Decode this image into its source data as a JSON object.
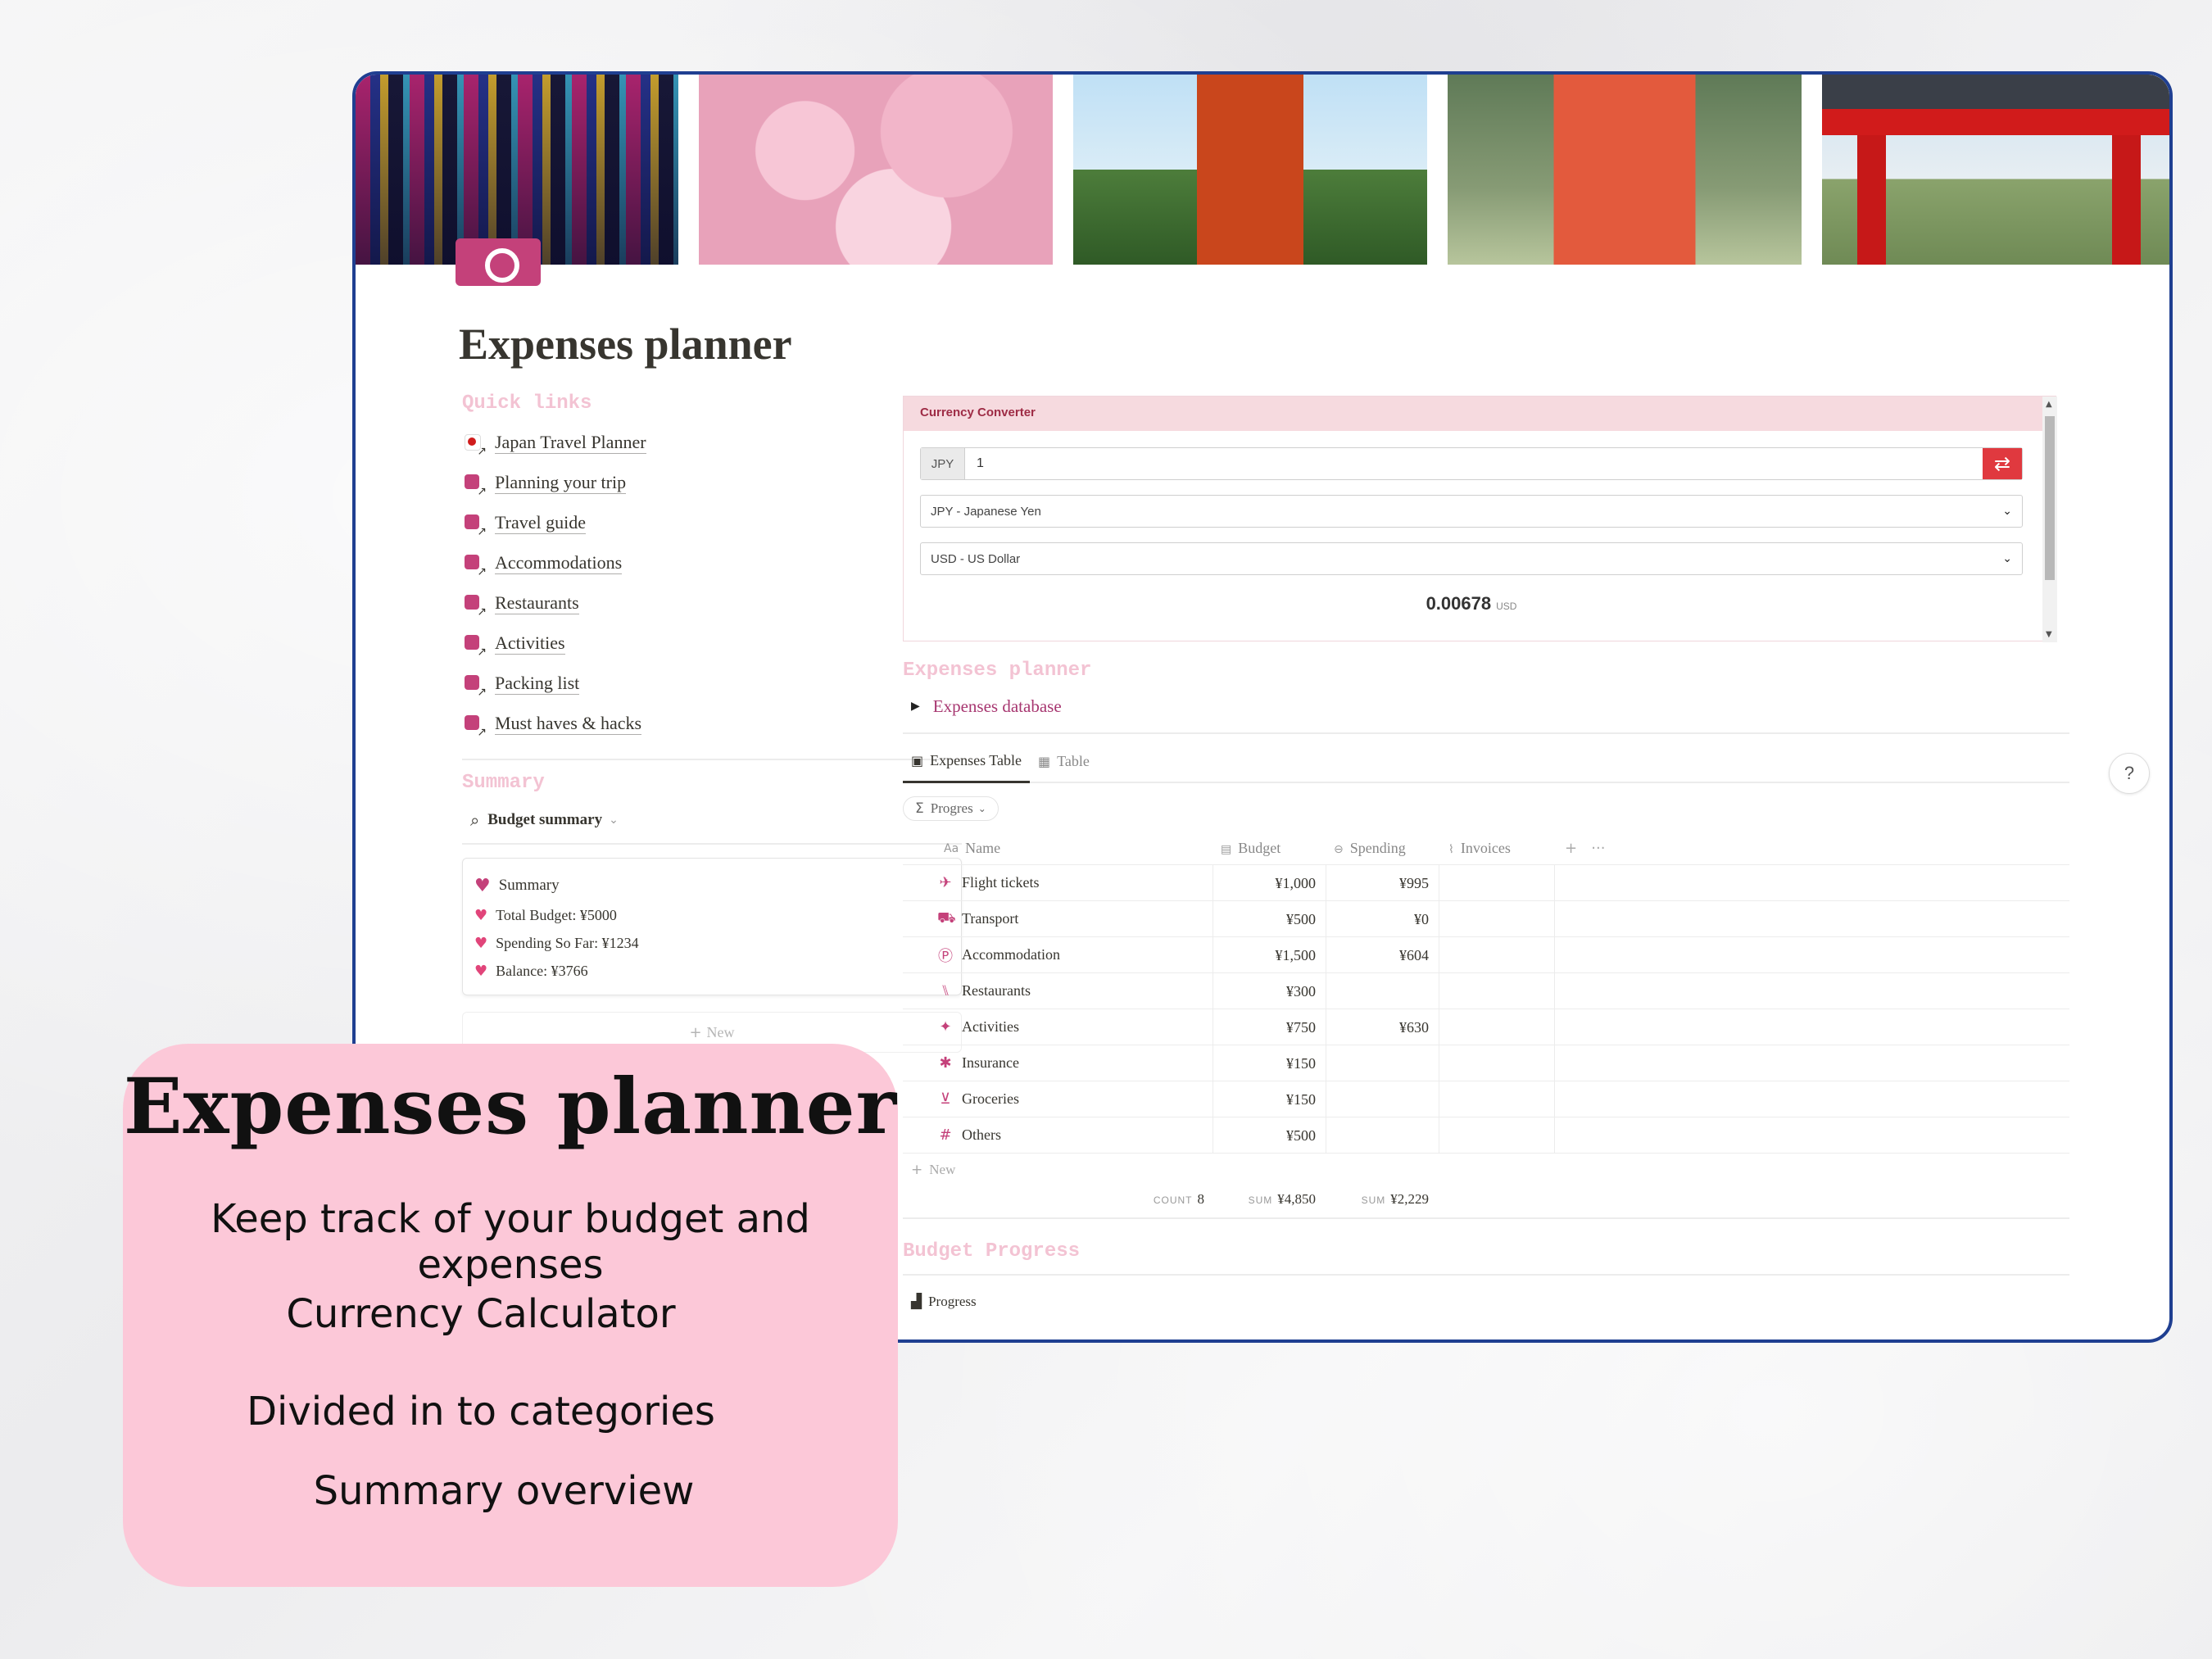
{
  "page": {
    "title": "Expenses planner"
  },
  "quick_links": {
    "heading": "Quick links",
    "items": [
      {
        "label": "Japan Travel Planner",
        "icon": "flag-icon"
      },
      {
        "label": "Planning your trip",
        "icon": "clock-icon"
      },
      {
        "label": "Travel guide",
        "icon": "book-icon"
      },
      {
        "label": "Accommodations",
        "icon": "signpost-icon"
      },
      {
        "label": "Restaurants",
        "icon": "utensils-icon"
      },
      {
        "label": "Activities",
        "icon": "mask-icon"
      },
      {
        "label": "Packing list",
        "icon": "luggage-icon"
      },
      {
        "label": "Must haves & hacks",
        "icon": "bulb-icon"
      }
    ]
  },
  "summary": {
    "heading": "Summary",
    "view_label": "Budget summary",
    "card_title": "Summary",
    "lines": [
      "Total Budget: ¥5000",
      "Spending So Far: ¥1234",
      "Balance: ¥3766"
    ],
    "new_label": "New"
  },
  "converter": {
    "header": "Currency Converter",
    "currency_tag": "JPY",
    "amount": "1",
    "from_option": "JPY - Japanese Yen",
    "to_option": "USD - US Dollar",
    "result": "0.00678",
    "result_unit": "USD"
  },
  "expenses": {
    "heading": "Expenses planner",
    "toggle_label": "Expenses database",
    "tabs": [
      {
        "label": "Expenses Table",
        "active": true
      },
      {
        "label": "Table",
        "active": false
      }
    ],
    "filter_label": "Progres",
    "columns": {
      "name": "Name",
      "budget": "Budget",
      "spending": "Spending",
      "invoices": "Invoices"
    },
    "rows": [
      {
        "name": "Flight tickets",
        "budget": "¥1,000",
        "spending": "¥995"
      },
      {
        "name": "Transport",
        "budget": "¥500",
        "spending": "¥0"
      },
      {
        "name": "Accommodation",
        "budget": "¥1,500",
        "spending": "¥604"
      },
      {
        "name": "Restaurants",
        "budget": "¥300",
        "spending": ""
      },
      {
        "name": "Activities",
        "budget": "¥750",
        "spending": "¥630"
      },
      {
        "name": "Insurance",
        "budget": "¥150",
        "spending": ""
      },
      {
        "name": "Groceries",
        "budget": "¥150",
        "spending": ""
      },
      {
        "name": "Others",
        "budget": "¥500",
        "spending": ""
      }
    ],
    "new_label": "New",
    "count_label": "COUNT",
    "count_value": "8",
    "sum_label": "SUM",
    "sum_budget": "¥4,850",
    "sum_spending": "¥2,229"
  },
  "budget_progress": {
    "heading": "Budget Progress",
    "view_label": "Progress"
  },
  "help": {
    "label": "?"
  },
  "promo": {
    "title": "Expenses planner",
    "lines": [
      "Keep track of your budget and expenses",
      "Currency  Calculator",
      "Divided in to categories",
      "Summary overview"
    ]
  },
  "colors": {
    "accent": "#c4417a",
    "promo_bg": "#fcc8d8",
    "window_border": "#1f3f91"
  }
}
